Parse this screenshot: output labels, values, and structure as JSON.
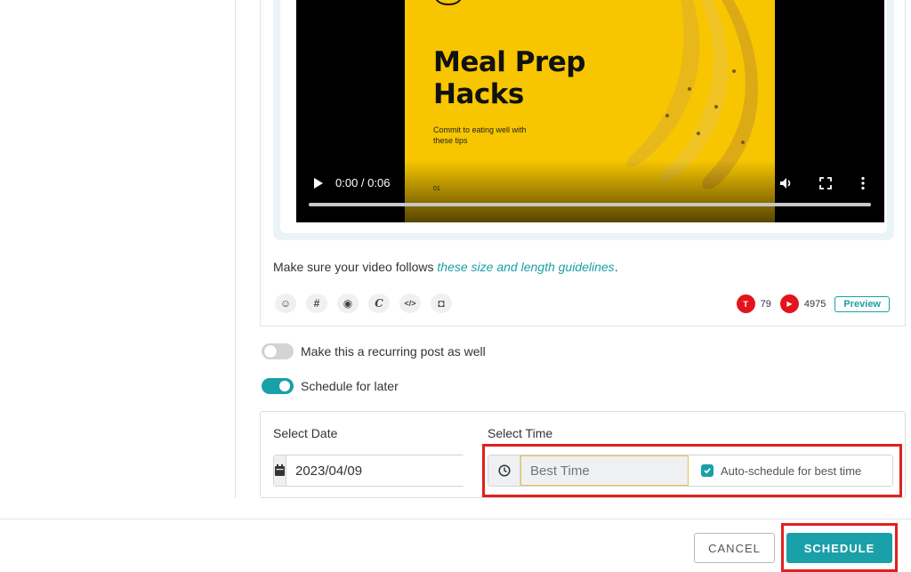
{
  "video": {
    "thumbnail_title": "Meal Prep Hacks",
    "thumbnail_subtitle": "Commit to eating well with these tips",
    "thumbnail_page": "01",
    "time_display": "0:00 / 0:06",
    "progress": 0
  },
  "composer": {
    "guideline_prefix": "Make sure your video follows ",
    "guideline_link": "these size and length guidelines",
    "guideline_suffix": ".",
    "tools": [
      "emoji-icon",
      "hashtag-icon",
      "media-icon",
      "canva-icon",
      "code-icon",
      "robot-icon"
    ],
    "tool_glyphs": [
      "☺",
      "#",
      "◉",
      "C",
      "</>",
      "◘"
    ],
    "counters": [
      {
        "badge": "T",
        "value": "79",
        "color": "#e3141c"
      },
      {
        "badge": "▶",
        "value": "4975",
        "color": "#e3141c"
      }
    ],
    "preview_label": "Preview"
  },
  "options": {
    "recurring_label": "Make this a recurring post as well",
    "recurring_on": false,
    "schedule_later_label": "Schedule for later",
    "schedule_later_on": true
  },
  "schedule": {
    "date_label": "Select Date",
    "date_value": "2023/04/09",
    "time_label": "Select Time",
    "time_placeholder": "Best Time",
    "auto_label": "Auto-schedule for best time",
    "auto_checked": true
  },
  "footer": {
    "cancel_label": "CANCEL",
    "schedule_label": "SCHEDULE"
  },
  "colors": {
    "accent": "#1aa0a8",
    "highlight": "#e02020",
    "thumb_bg": "#f7c600"
  }
}
